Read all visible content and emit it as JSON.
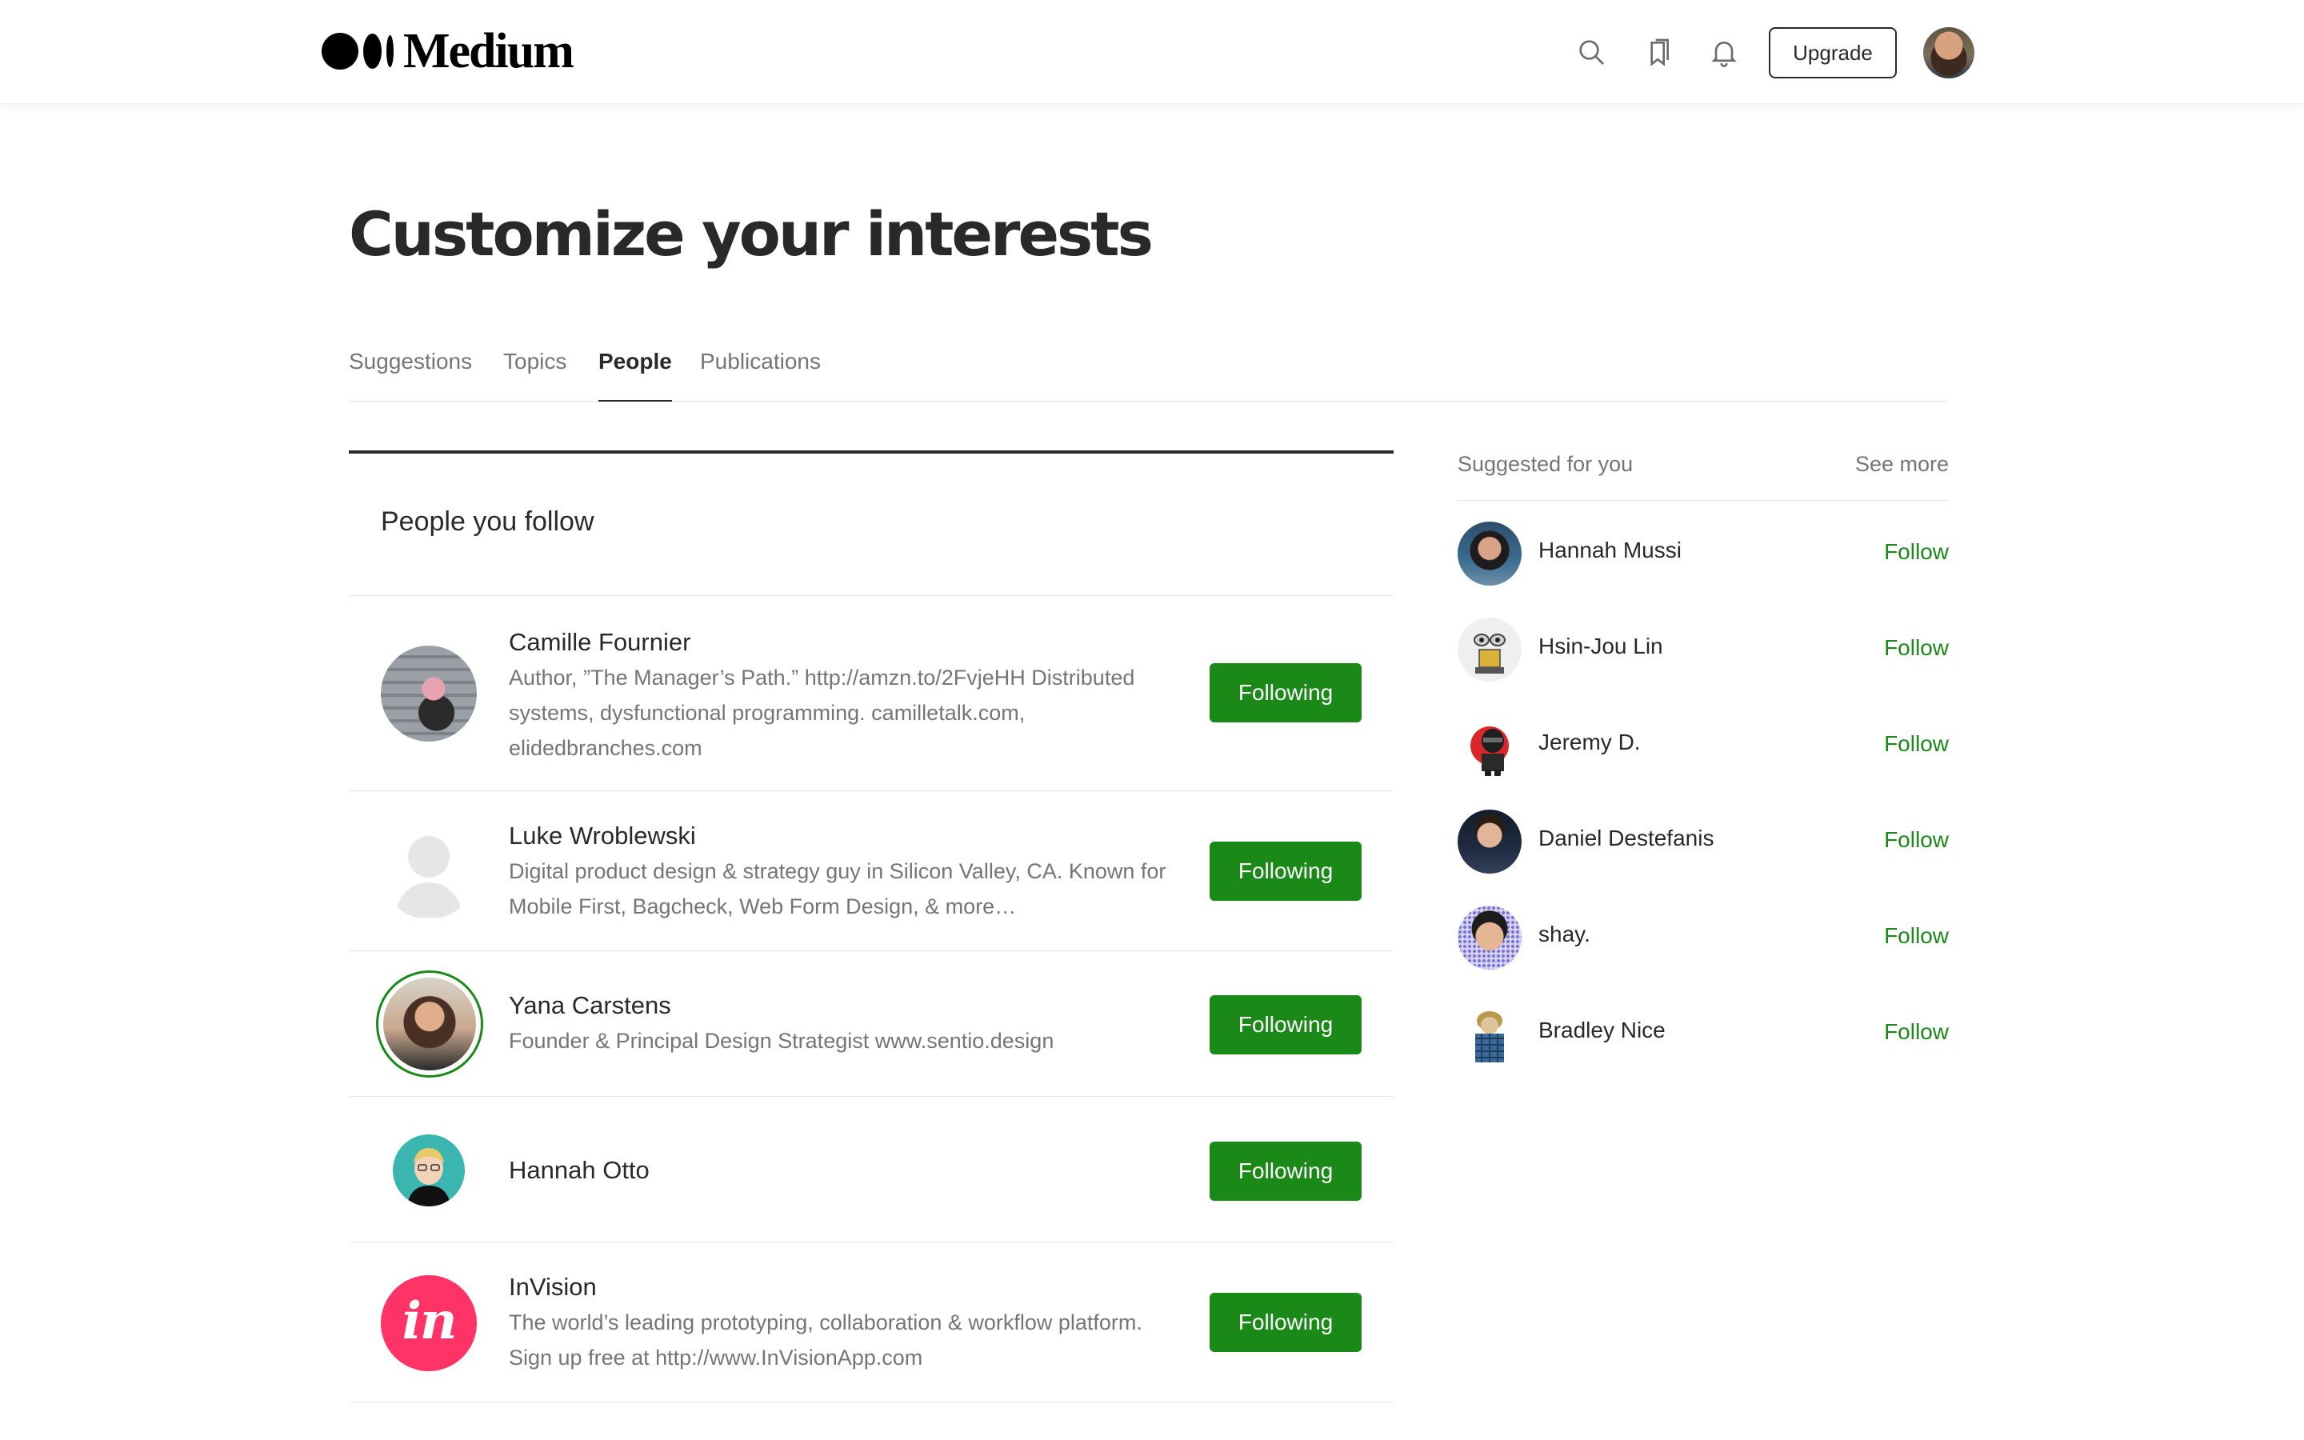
{
  "app": {
    "logo_text": "Medium",
    "upgrade_label": "Upgrade",
    "icons": [
      "search-icon",
      "bookmarks-icon",
      "notifications-icon"
    ]
  },
  "page": {
    "title": "Customize your interests",
    "tabs": [
      {
        "label": "Suggestions",
        "active": false
      },
      {
        "label": "Topics",
        "active": false
      },
      {
        "label": "People",
        "active": true
      },
      {
        "label": "Publications",
        "active": false
      }
    ]
  },
  "following": {
    "title": "People you follow",
    "button_label": "Following",
    "people": [
      {
        "name": "Camille Fournier",
        "bio": "Author, ”The Manager’s Path.” http://amzn.to/2FvjeHH Distributed systems, dysfunctional programming. camilletalk.com, elidedbranches.com"
      },
      {
        "name": "Luke Wroblewski",
        "bio": "Digital product design & strategy guy in Silicon Valley, CA. Known for Mobile First, Bagcheck, Web Form Design, & more…"
      },
      {
        "name": "Yana Carstens",
        "bio": "Founder & Principal Design Strategist www.sentio.design"
      },
      {
        "name": "Hannah Otto",
        "bio": ""
      },
      {
        "name": "InVision",
        "bio": "The world’s leading prototyping, collaboration & workflow platform. Sign up free at http://www.InVisionApp.com"
      }
    ]
  },
  "suggested": {
    "title": "Suggested for you",
    "see_more": "See more",
    "follow_label": "Follow",
    "people": [
      {
        "name": "Hannah Mussi"
      },
      {
        "name": "Hsin-Jou Lin"
      },
      {
        "name": "Jeremy D."
      },
      {
        "name": "Daniel Destefanis"
      },
      {
        "name": "shay."
      },
      {
        "name": "Bradley Nice"
      }
    ]
  },
  "colors": {
    "accent_green": "#1a8917",
    "text_dark": "#292929",
    "text_muted": "#757575",
    "invision_pink": "#ff3366"
  }
}
